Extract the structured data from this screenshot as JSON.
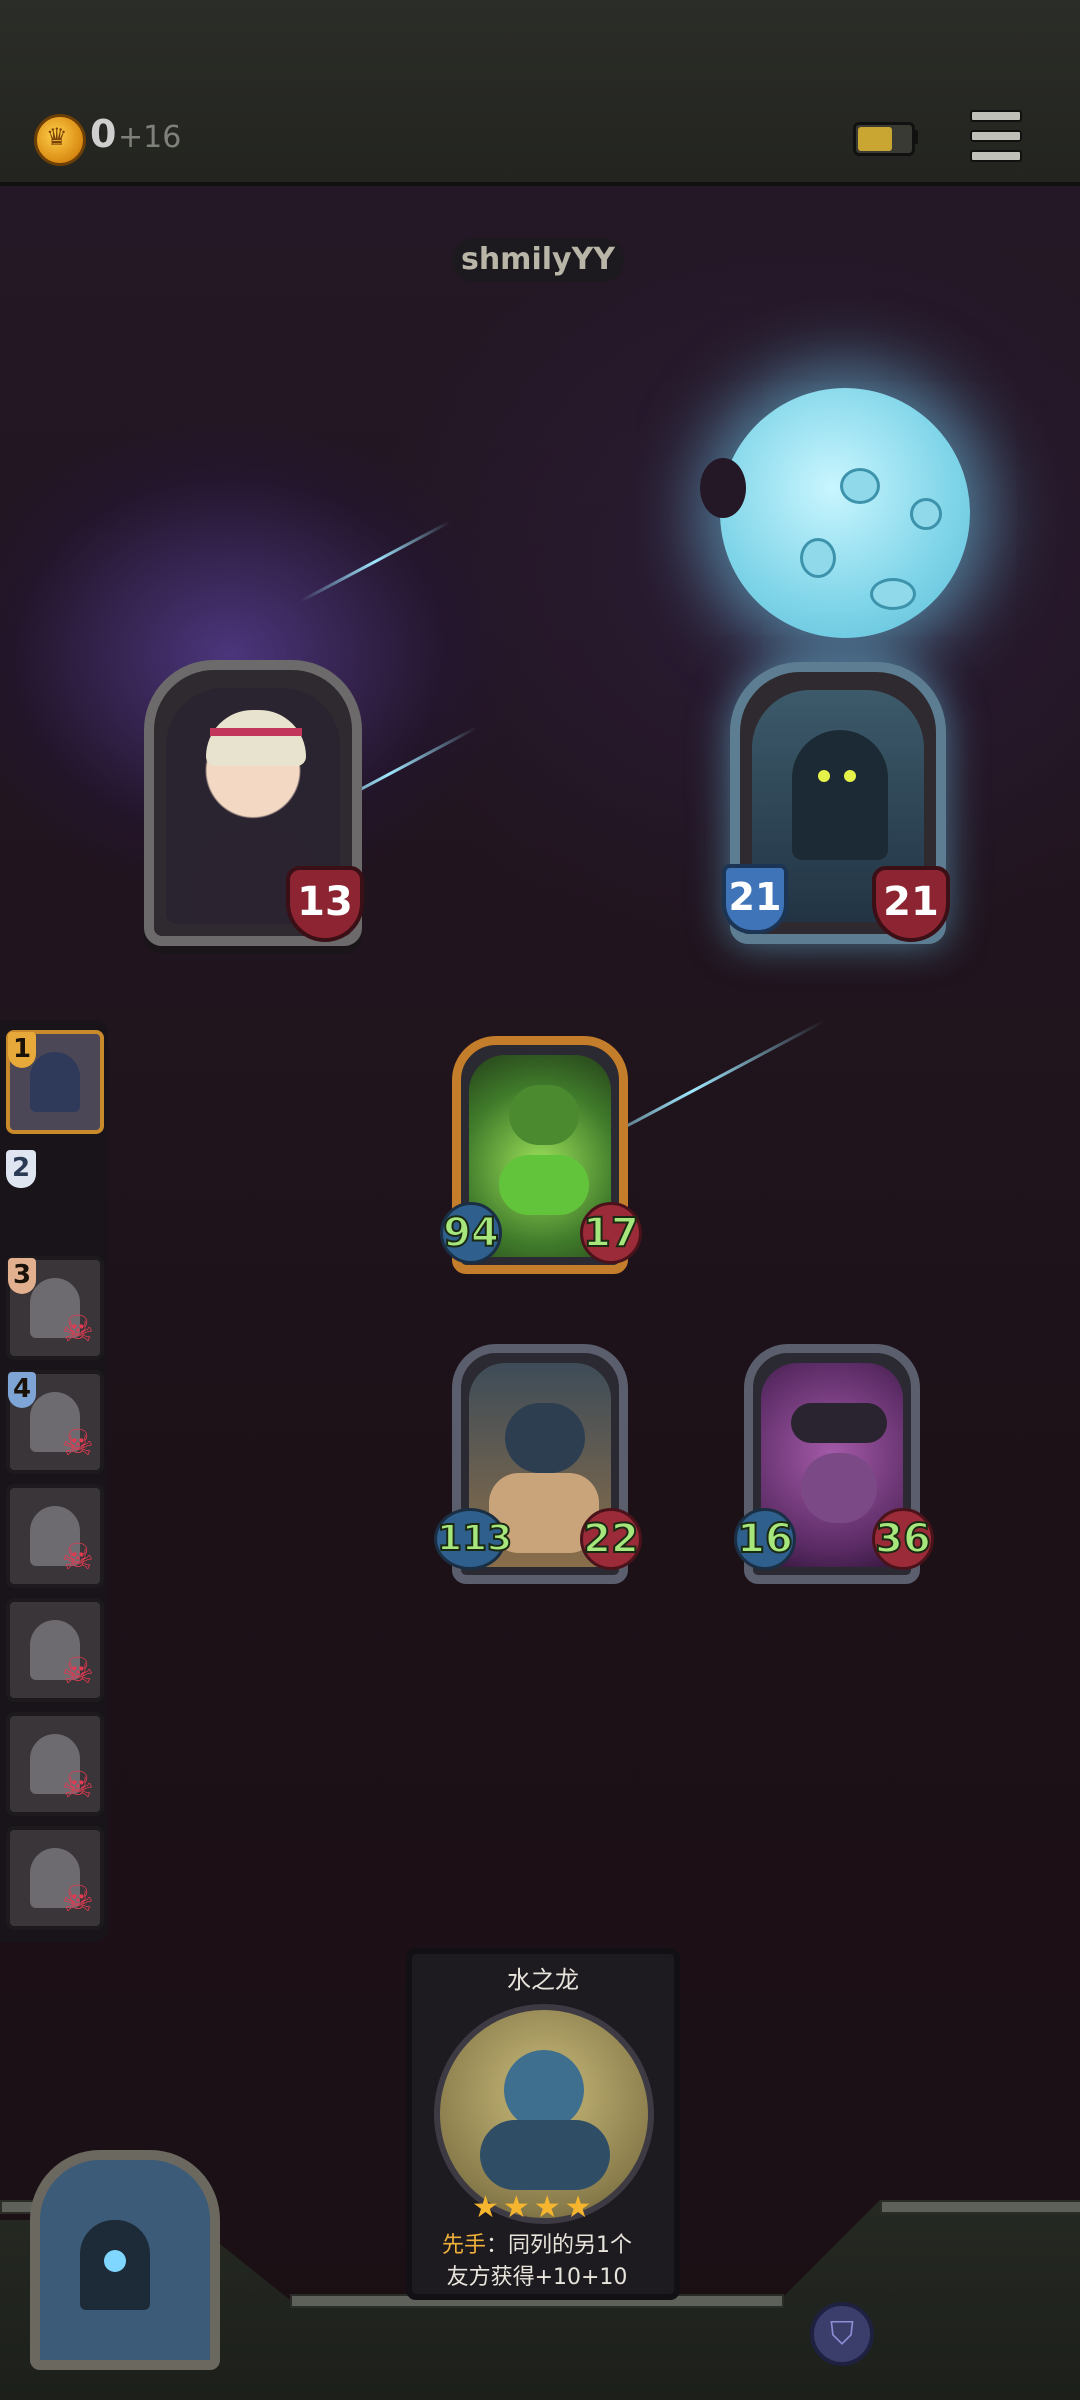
{
  "header": {
    "gold": "0",
    "gold_gain": "+16",
    "coin_icon": "crown-coin-icon",
    "battery_level": 0.65,
    "menu_icon": "hamburger-menu-icon"
  },
  "opponent": {
    "name": "shmilyYY"
  },
  "heroes": {
    "player": {
      "health": "13"
    },
    "enemy": {
      "armor": "21",
      "health": "21"
    }
  },
  "board": {
    "enemy_units": [
      {
        "attack": "94",
        "health": "17"
      }
    ],
    "ally_units": [
      {
        "attack": "113",
        "health": "22"
      },
      {
        "attack": "16",
        "health": "36"
      }
    ]
  },
  "sidebar": {
    "slots": [
      {
        "rank": "1",
        "dead": false
      },
      {
        "rank": "2",
        "dead": false
      },
      {
        "rank": "3",
        "dead": true
      },
      {
        "rank": "4",
        "dead": true
      },
      {
        "rank": "",
        "dead": true
      },
      {
        "rank": "",
        "dead": true
      },
      {
        "rank": "",
        "dead": true
      },
      {
        "rank": "",
        "dead": true
      }
    ]
  },
  "hand_card": {
    "name": "水之龙",
    "stars": "★★★★",
    "keyword": "先手",
    "desc_rest": "：同列的另1个",
    "desc_line2": "友方获得+10+10"
  },
  "colors": {
    "gold": "#f5b52e",
    "hp": "#9b2b38",
    "atk": "#2f5f8c",
    "stat_text": "#a6e67c"
  }
}
